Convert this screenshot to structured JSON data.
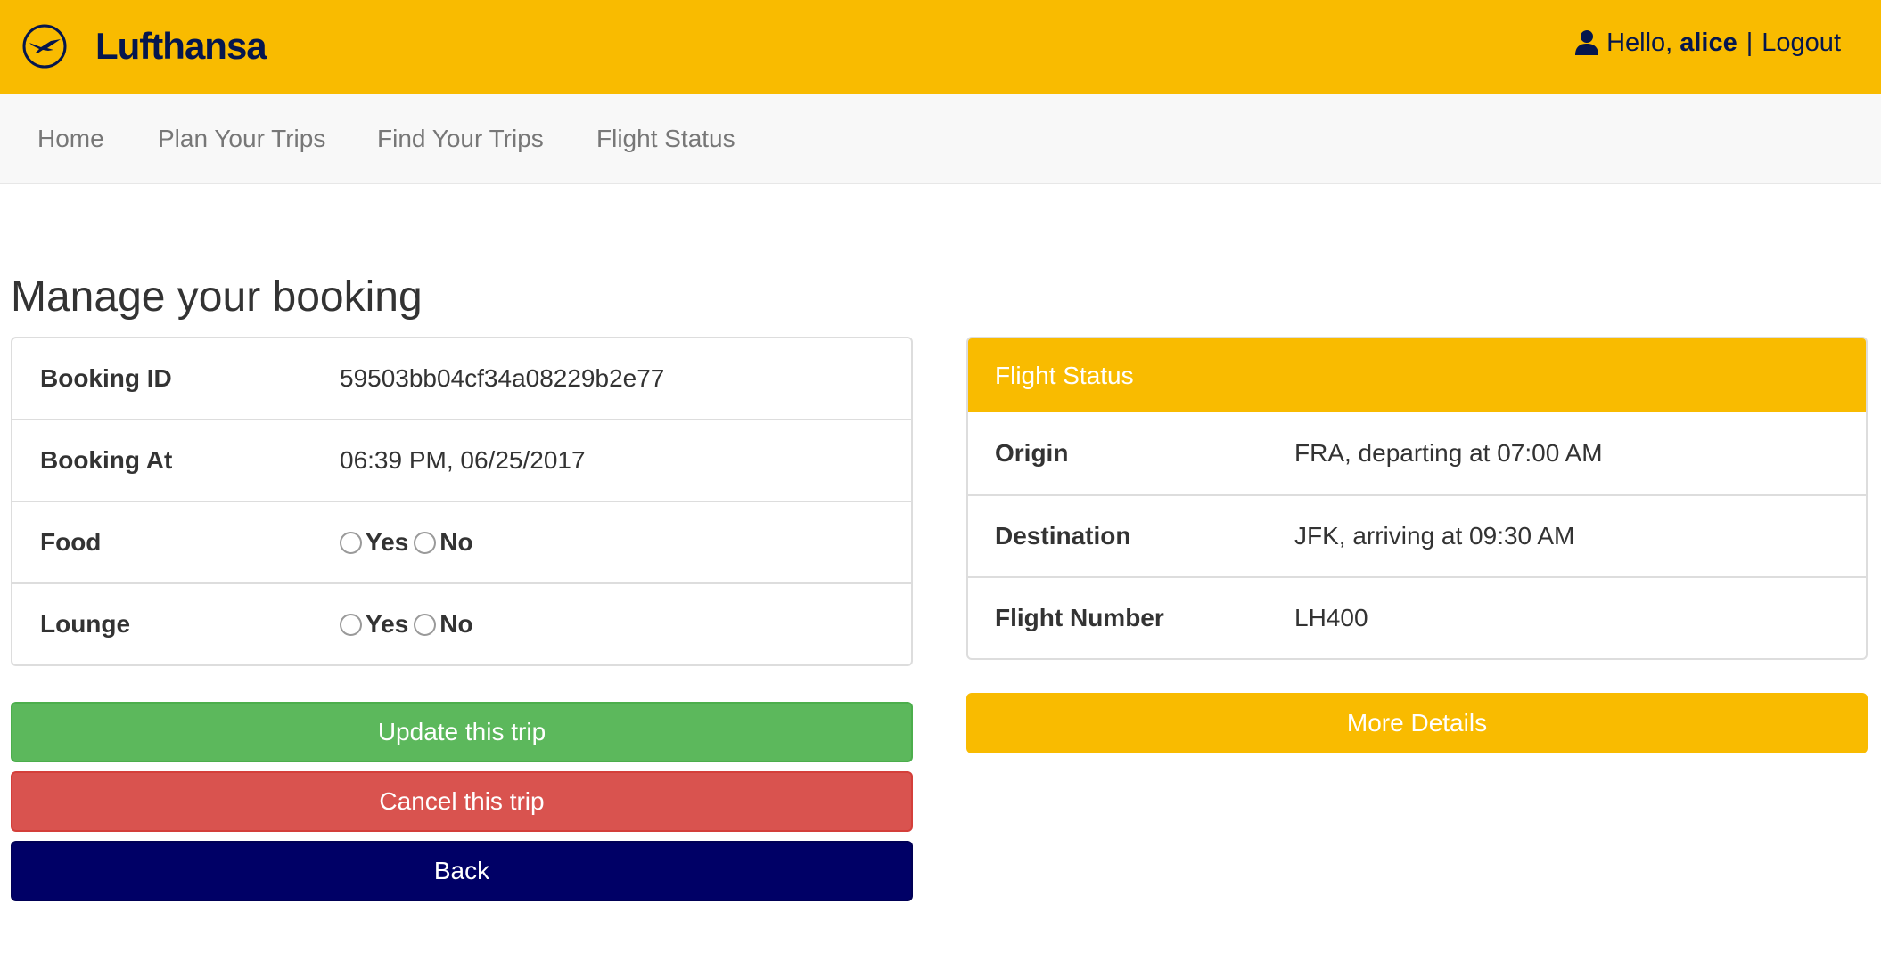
{
  "header": {
    "brand": "Lufthansa",
    "logo_icon": "lufthansa-crane-icon",
    "user_icon": "user-icon",
    "greeting": "Hello,",
    "username": "alice",
    "separator": "|",
    "logout_label": "Logout",
    "background_color": "#f9bb00",
    "brand_color": "#05164d"
  },
  "nav": {
    "items": [
      {
        "label": "Home"
      },
      {
        "label": "Plan Your Trips"
      },
      {
        "label": "Find Your Trips"
      },
      {
        "label": "Flight Status"
      }
    ]
  },
  "page": {
    "title": "Manage your booking"
  },
  "booking": {
    "id_label": "Booking ID",
    "id_value": "59503bb04cf34a08229b2e77",
    "at_label": "Booking At",
    "at_value": "06:39 PM, 06/25/2017",
    "food_label": "Food",
    "lounge_label": "Lounge",
    "yes_label": "Yes",
    "no_label": "No"
  },
  "buttons": {
    "update": "Update this trip",
    "cancel": "Cancel this trip",
    "back": "Back",
    "more_details": "More Details",
    "update_color": "#5cb85c",
    "cancel_color": "#d9534f",
    "back_color": "#000066",
    "more_color": "#f9bb00"
  },
  "flight_status": {
    "heading": "Flight Status",
    "origin_label": "Origin",
    "origin_value": "FRA, departing at 07:00 AM",
    "destination_label": "Destination",
    "destination_value": "JFK, arriving at 09:30 AM",
    "flight_number_label": "Flight Number",
    "flight_number_value": "LH400"
  }
}
